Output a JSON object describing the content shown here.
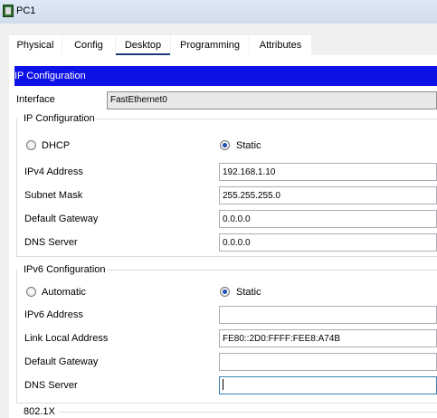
{
  "window": {
    "title": "PC1"
  },
  "tabs": [
    {
      "label": "Physical"
    },
    {
      "label": "Config"
    },
    {
      "label": "Desktop"
    },
    {
      "label": "Programming"
    },
    {
      "label": "Attributes"
    }
  ],
  "active_tab": "Desktop",
  "header": {
    "title": "IP Configuration"
  },
  "interface": {
    "label": "Interface",
    "value": "FastEthernet0"
  },
  "ipv4": {
    "title": "IP Configuration",
    "dhcp_label": "DHCP",
    "static_label": "Static",
    "selected_mode": "Static",
    "address_label": "IPv4 Address",
    "address": "192.168.1.10",
    "mask_label": "Subnet Mask",
    "mask": "255.255.255.0",
    "gateway_label": "Default Gateway",
    "gateway": "0.0.0.0",
    "dns_label": "DNS Server",
    "dns": "0.0.0.0"
  },
  "ipv6": {
    "title": "IPv6 Configuration",
    "auto_label": "Automatic",
    "static_label": "Static",
    "selected_mode": "Static",
    "address_label": "IPv6 Address",
    "address": "",
    "link_local_label": "Link Local Address",
    "link_local": "FE80::2D0:FFFF:FEE8:A74B",
    "gateway_label": "Default Gateway",
    "gateway": "",
    "dns_label": "DNS Server",
    "dns": ""
  },
  "dot1x": {
    "title": "802.1X"
  }
}
